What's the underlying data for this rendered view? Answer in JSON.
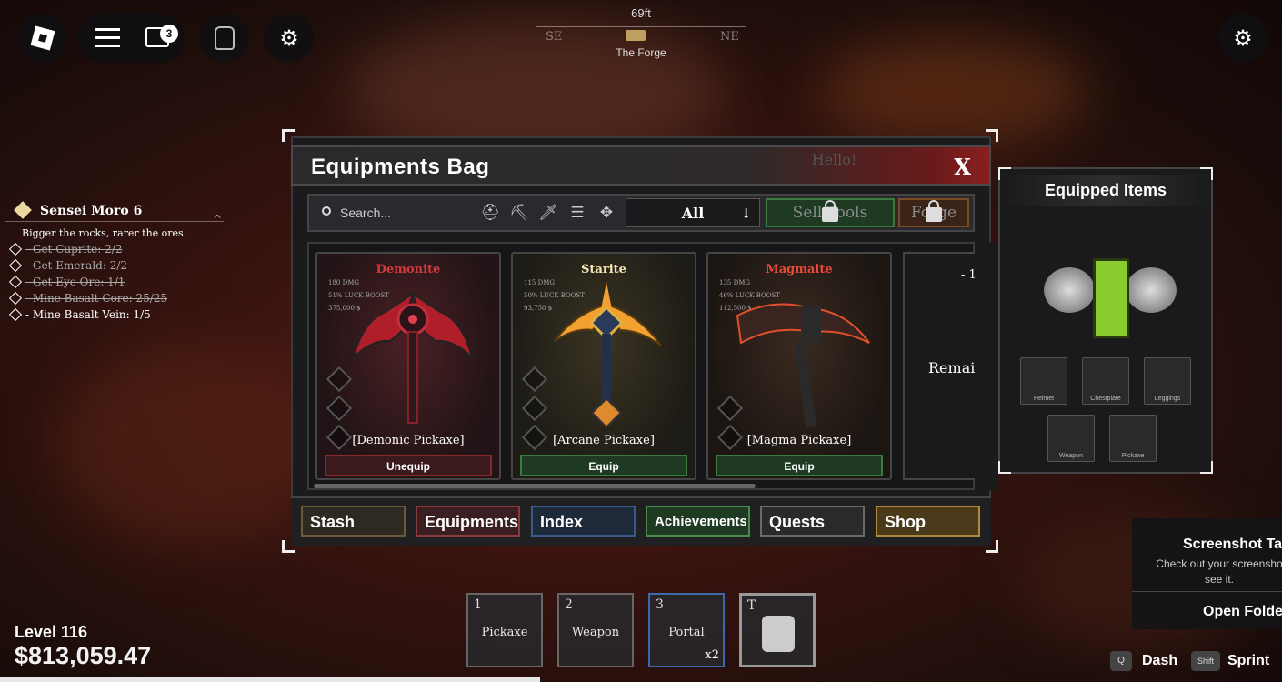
{
  "topbar": {
    "chat_badge": "3"
  },
  "compass": {
    "distance": "69ft",
    "dirs": [
      "SE",
      "NE"
    ],
    "location": "The Forge"
  },
  "quest": {
    "title": "Sensei Moro 6",
    "description": "Bigger the rocks, rarer the ores.",
    "objectives": [
      {
        "text": "- Get Cuprite: 2/2",
        "done": true
      },
      {
        "text": "- Get Emerald: 2/2",
        "done": true
      },
      {
        "text": "- Get Eye Ore: 1/1",
        "done": true
      },
      {
        "text": "- Mine Basalt Core: 25/25",
        "done": true
      },
      {
        "text": "- Mine Basalt Vein: 1/5",
        "done": false
      }
    ]
  },
  "window": {
    "title": "Equipments Bag",
    "close": "X",
    "hello": "Hello!",
    "search_placeholder": "Search...",
    "filter": "All",
    "sell_label": "Sell Tools",
    "forge_label": "Forge"
  },
  "items": [
    {
      "name": "Demonite",
      "color": "#d23a3a",
      "dmg": "180 DMG",
      "luck": "51% LUCK BOOST",
      "price": "375,000 $",
      "item": "[Demonic Pickaxe]",
      "action": "Unequip"
    },
    {
      "name": "Starite",
      "color": "#f5e6b0",
      "dmg": "115 DMG",
      "luck": "50% LUCK BOOST",
      "price": "93,750 $",
      "item": "[Arcane Pickaxe]",
      "action": "Equip"
    },
    {
      "name": "Magmaite",
      "color": "#e84a3a",
      "dmg": "135 DMG",
      "luck": "46% LUCK BOOST",
      "price": "112,500 $",
      "item": "[Magma Pickaxe]",
      "action": "Equip"
    }
  ],
  "partial_card": {
    "text": "Remai",
    "top": "- 1"
  },
  "tabs": [
    {
      "label": "Stash",
      "color": "#2e2a22",
      "border": "#6a5a3a"
    },
    {
      "label": "Equipments",
      "color": "#3a1e22",
      "border": "#8a3a3a"
    },
    {
      "label": "Index",
      "color": "#1e2a3a",
      "border": "#3a5a8a"
    },
    {
      "label": "Achievements",
      "color": "#1e3a22",
      "border": "#4a8a4a"
    },
    {
      "label": "Quests",
      "color": "#2a2a2c",
      "border": "#6a6a6a"
    },
    {
      "label": "Shop",
      "color": "#4a3a1a",
      "border": "#b08a3a"
    }
  ],
  "equipped": {
    "title": "Equipped Items",
    "slots": [
      "Helmet",
      "Chestplate",
      "Leggings",
      "Weapon",
      "Pickaxe"
    ]
  },
  "player": {
    "level": "Level 116",
    "money": "$813,059.47"
  },
  "hotbar": [
    {
      "num": "1",
      "label": "Pickaxe"
    },
    {
      "num": "2",
      "label": "Weapon"
    },
    {
      "num": "3",
      "label": "Portal",
      "count": "x2"
    },
    {
      "num": "T",
      "label": ""
    }
  ],
  "keys": [
    {
      "key": "Q",
      "label": "Dash"
    },
    {
      "key": "Shift",
      "label": "Sprint"
    }
  ],
  "toast": {
    "title": "Screenshot Ta",
    "body": "Check out your screensho see it.",
    "action": "Open Folde"
  }
}
